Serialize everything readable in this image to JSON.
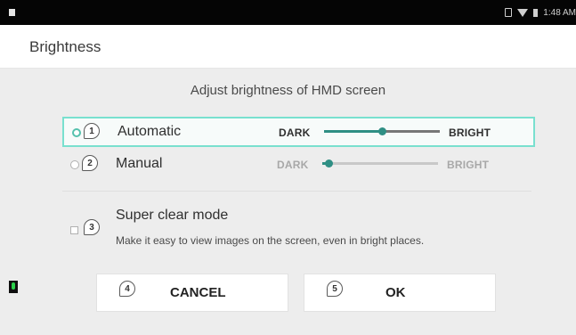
{
  "status_bar": {
    "time": "1:48 AM",
    "icons": [
      "sim-icon",
      "wifi-icon",
      "battery-icon"
    ]
  },
  "header": {
    "title": "Brightness"
  },
  "main": {
    "heading": "Adjust brightness of HMD screen",
    "options": [
      {
        "number": "1",
        "label": "Automatic",
        "selected": true,
        "dark_label": "DARK",
        "bright_label": "BRIGHT",
        "level": 0.5
      },
      {
        "number": "2",
        "label": "Manual",
        "selected": false,
        "dark_label": "DARK",
        "bright_label": "BRIGHT",
        "level": 0.05
      }
    ],
    "super_clear": {
      "number": "3",
      "title": "Super clear mode",
      "description": "Make it easy to view images on the screen, even in bright places.",
      "checked": false
    }
  },
  "buttons": {
    "cancel": {
      "number": "4",
      "label": "CANCEL"
    },
    "ok": {
      "number": "5",
      "label": "OK"
    }
  },
  "colors": {
    "accent": "#2f8f84",
    "selection_border": "#79e0cf"
  }
}
